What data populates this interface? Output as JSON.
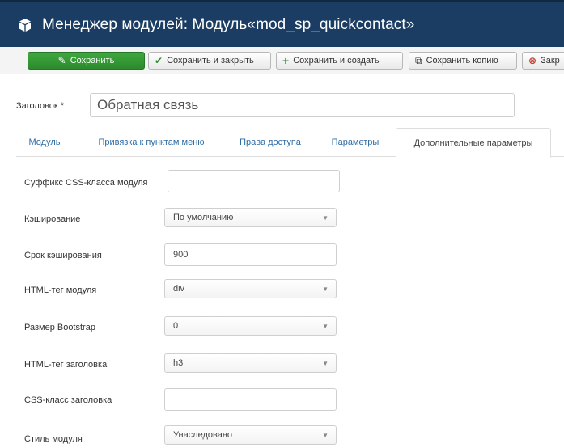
{
  "header": {
    "title": "Менеджер модулей: Модуль«mod_sp_quickcontact»",
    "icon": "cube-icon"
  },
  "toolbar": {
    "save": "Сохранить",
    "save_close": "Сохранить и закрыть",
    "save_new": "Сохранить и создать",
    "save_copy": "Сохранить копию",
    "close": "Закр"
  },
  "title_field": {
    "label": "Заголовок *",
    "value": "Обратная связь"
  },
  "tabs": [
    {
      "label": "Модуль"
    },
    {
      "label": "Привязка к пунктам меню"
    },
    {
      "label": "Права доступа"
    },
    {
      "label": "Параметры"
    },
    {
      "label": "Дополнительные параметры"
    }
  ],
  "fields": {
    "css_suffix": {
      "label": "Суффикс CSS-класса модуля",
      "value": ""
    },
    "caching": {
      "label": "Кэширование",
      "value": "По умолчанию"
    },
    "cache_time": {
      "label": "Срок кэширования",
      "value": "900"
    },
    "module_tag": {
      "label": "HTML-тег модуля",
      "value": "div"
    },
    "bootstrap_size": {
      "label": "Размер Bootstrap",
      "value": "0"
    },
    "header_tag": {
      "label": "HTML-тег заголовка",
      "value": "h3"
    },
    "header_class": {
      "label": "CSS-класс заголовка",
      "value": ""
    },
    "module_style": {
      "label": "Стиль модуля",
      "value": "Унаследовано"
    }
  },
  "colors": {
    "header_bg": "#1b3d63",
    "save_green": "#2c8a2c",
    "link_blue": "#2e6ca4",
    "close_red": "#c0392b"
  }
}
